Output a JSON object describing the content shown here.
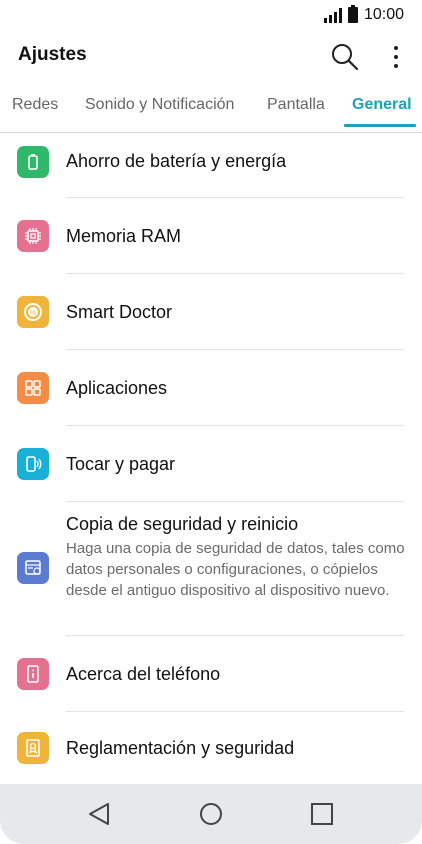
{
  "status": {
    "time": "10:00"
  },
  "appbar": {
    "title": "Ajustes"
  },
  "tabs": [
    {
      "label": "Redes"
    },
    {
      "label": "Sonido y Notificación"
    },
    {
      "label": "Pantalla"
    },
    {
      "label": "General"
    }
  ],
  "items": [
    {
      "label": "Ahorro de batería y energía",
      "icon": "battery-icon",
      "color": "#2fb86a"
    },
    {
      "label": "Memoria RAM",
      "icon": "chip-icon",
      "color": "#e3718f"
    },
    {
      "label": "Smart Doctor",
      "icon": "smart-doctor-icon",
      "color": "#f0b43a"
    },
    {
      "label": "Aplicaciones",
      "icon": "apps-grid-icon",
      "color": "#f58c45"
    },
    {
      "label": "Tocar y pagar",
      "icon": "tap-pay-icon",
      "color": "#18b1d5"
    },
    {
      "label": "Copia de seguridad y reinicio",
      "description": "Haga una copia de seguridad de datos, tales como datos personales o configuraciones, o cópielos desde el antiguo dispositivo al dispositivo nuevo.",
      "icon": "backup-icon",
      "color": "#5a7bd0"
    },
    {
      "label": "Acerca del teléfono",
      "icon": "info-phone-icon",
      "color": "#e3718f"
    },
    {
      "label": "Reglamentación y seguridad",
      "icon": "certificate-icon",
      "color": "#f0b43a"
    }
  ]
}
